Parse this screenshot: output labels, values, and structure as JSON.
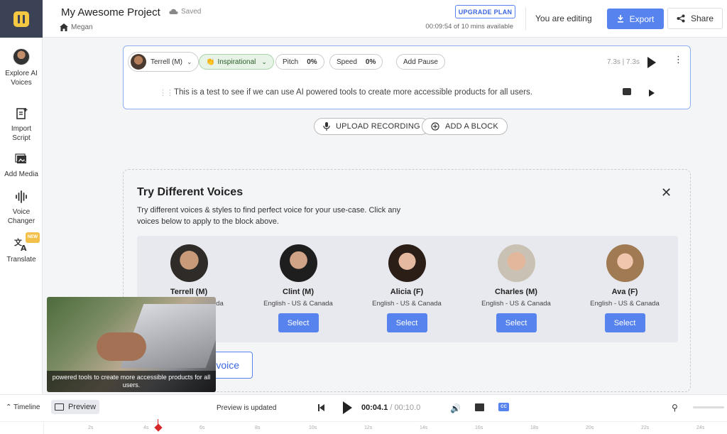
{
  "header": {
    "project_title": "My Awesome Project",
    "saved_status": "Saved",
    "breadcrumb_user": "Megan",
    "upgrade_label": "UPGRADE PLAN",
    "quota_text": "00:09:54 of 10 mins available",
    "editing_label": "You are editing",
    "export_label": "Export",
    "share_label": "Share"
  },
  "sidebar": {
    "items": [
      {
        "label": "Explore AI Voices",
        "icon": "voice-avatar"
      },
      {
        "label": "Import Script",
        "icon": "import-icon"
      },
      {
        "label": "Add Media",
        "icon": "media-icon"
      },
      {
        "label": "Voice Changer",
        "icon": "waveform-icon"
      },
      {
        "label": "Translate",
        "icon": "translate-icon",
        "badge": "NEW"
      }
    ]
  },
  "block": {
    "voice": "Terrell (M)",
    "style": "Inspirational",
    "pitch_label": "Pitch",
    "pitch_value": "0%",
    "speed_label": "Speed",
    "speed_value": "0%",
    "pause_label": "Add Pause",
    "duration": "7.3s | 7.3s",
    "script": "This is a test to see if we can use AI powered tools to create more accessible products for all users."
  },
  "actions": {
    "upload_label": "UPLOAD RECORDING",
    "add_block_label": "ADD A BLOCK"
  },
  "voices_panel": {
    "title": "Try Different Voices",
    "description": "Try different voices & styles to find perfect voice for your use-case. Click any voices below to apply to the block above.",
    "select_label": "Select",
    "custom_voice_label": "voice",
    "voices": [
      {
        "name": "Terrell (M)",
        "lang": "English - US & Canada"
      },
      {
        "name": "Clint (M)",
        "lang": "English - US & Canada"
      },
      {
        "name": "Alicia (F)",
        "lang": "English - US & Canada"
      },
      {
        "name": "Charles (M)",
        "lang": "English - US & Canada"
      },
      {
        "name": "Ava (F)",
        "lang": "English - US & Canada"
      }
    ]
  },
  "video_preview": {
    "caption": "powered tools to create more accessible products for all users."
  },
  "bottom_bar": {
    "timeline_label": "Timeline",
    "preview_label": "Preview",
    "status": "Preview is updated",
    "current_time": "00:04.1",
    "total_time": " / 00:10.0",
    "cc_label": "CC"
  },
  "ruler": {
    "ticks": [
      "2s",
      "4s",
      "6s",
      "8s",
      "10s",
      "12s",
      "14s",
      "16s",
      "18s",
      "20s",
      "22s",
      "24s"
    ]
  },
  "colors": {
    "accent": "#5783EE",
    "sidebar_logo_bg": "#3B4256",
    "logo_yellow": "#F5C842",
    "style_chip_bg": "#E6F3E6",
    "playhead": "#D62828"
  }
}
